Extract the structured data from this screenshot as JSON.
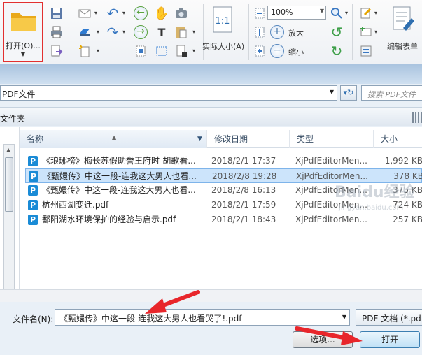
{
  "toolbar": {
    "open_label": "打开(O)...",
    "actual_size_label": "实际大小(A)",
    "zoom_value": "100%",
    "zoom_in_label": "放大",
    "zoom_out_label": "缩小",
    "edit_form_label": "编辑表单"
  },
  "dialog": {
    "address": "PDF文件",
    "search_placeholder": "搜索 PDF文件",
    "folder_label": "文件夹",
    "columns": {
      "name": "名称",
      "date": "修改日期",
      "type": "类型",
      "size": "大小"
    },
    "files": [
      {
        "name": "《琅琊榜》梅长苏假助誉王府时-胡歌看...",
        "date": "2018/2/1 17:37",
        "type": "XjPdfEditorMen...",
        "size": "1,992 KB",
        "selected": false
      },
      {
        "name": "《甄嬛传》中这一段-连我这大男人也看...",
        "date": "2018/2/8 19:28",
        "type": "XjPdfEditorMen...",
        "size": "378 KB",
        "selected": true
      },
      {
        "name": "《甄嬛传》中这一段-连我这大男人也看...",
        "date": "2018/2/8 16:13",
        "type": "XjPdfEditorMen...",
        "size": "375 KB",
        "selected": false
      },
      {
        "name": "杭州西湖变迁.pdf",
        "date": "2018/2/1 17:59",
        "type": "XjPdfEditorMen...",
        "size": "724 KB",
        "selected": false
      },
      {
        "name": "鄱阳湖水环境保护的经验与启示.pdf",
        "date": "2018/2/1 18:43",
        "type": "XjPdfEditorMen...",
        "size": "257 KB",
        "selected": false
      }
    ],
    "filename_label": "文件名(N):",
    "filename_value": "《甄嬛传》中这一段-连我这大男人也看哭了!.pdf",
    "filetype_value": "PDF 文档 (*.pdf",
    "browse_label": "选项...",
    "open_button_label": "打开"
  },
  "watermark": {
    "brand": "Baidu经验",
    "url": "jingyan.baidu.com"
  },
  "colors": {
    "highlight_border": "#e23030",
    "selection": "#cce4fb",
    "arrow": "#e8262b",
    "pdf_icon": "#1a8bd6"
  }
}
